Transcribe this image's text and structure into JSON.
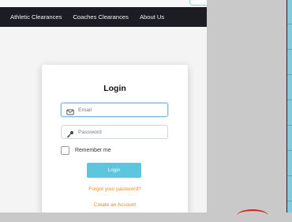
{
  "nav": {
    "links": [
      "Athletic Clearances",
      "Coaches Clearances",
      "About Us"
    ]
  },
  "login": {
    "title": "Login",
    "email_placeholder": "Email",
    "password_placeholder": "Password",
    "remember_label": "Remember me",
    "login_button": "Login",
    "forgot_link": "Forgot your password?",
    "create_link": "Create an Account"
  },
  "colors": {
    "navbar": "#1b1d22",
    "login_button": "#5bc6dd",
    "link": "#f08a1b",
    "focus_border": "#7eb6e6"
  },
  "icons": {
    "email": "envelope-icon",
    "password": "key-icon"
  }
}
